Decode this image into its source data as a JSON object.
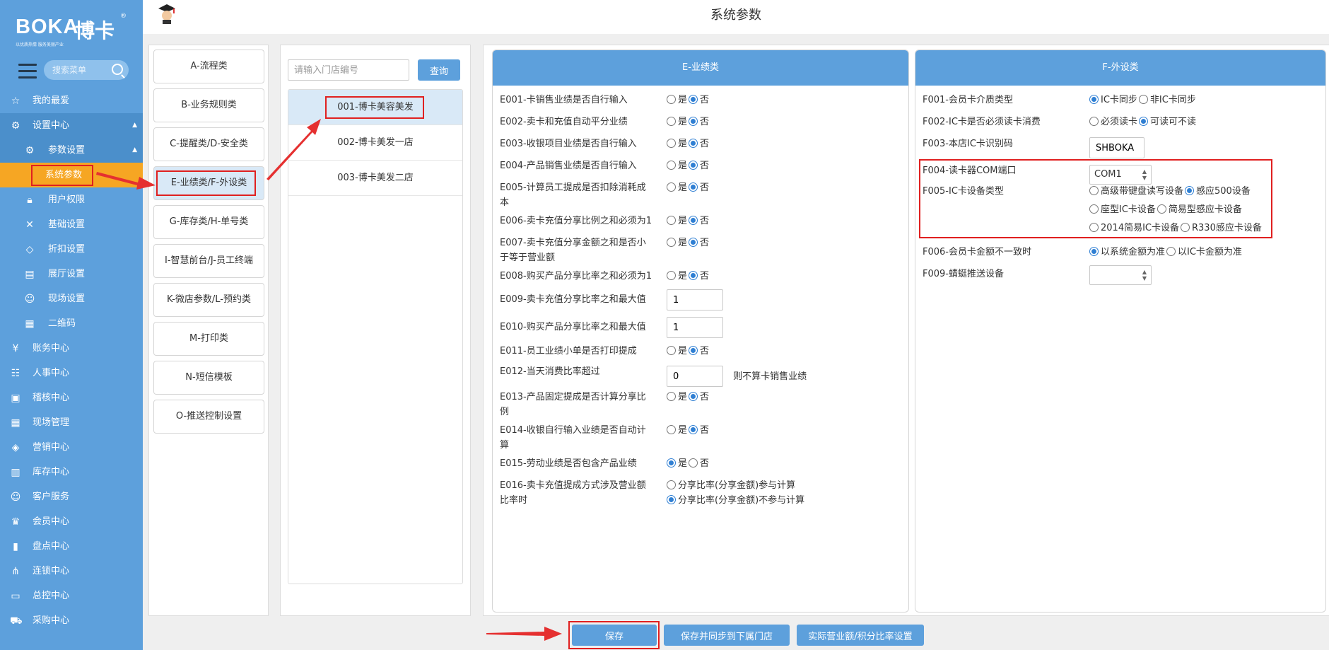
{
  "logo": {
    "brand": "BOKA",
    "brand_cn": "博卡",
    "reg": "®",
    "tagline": "以优质热情 服务美丽产业"
  },
  "sidebar": {
    "search_placeholder": "搜索菜单",
    "items": [
      {
        "label": "我的最爱",
        "icon": "star-icon"
      },
      {
        "label": "设置中心",
        "icon": "settings-icon"
      },
      {
        "label": "参数设置",
        "icon": "params-icon"
      },
      {
        "label": "系统参数",
        "icon": ""
      },
      {
        "label": "用户权限",
        "icon": "lock-icon"
      },
      {
        "label": "基础设置",
        "icon": "tools-icon"
      },
      {
        "label": "折扣设置",
        "icon": "tag-icon"
      },
      {
        "label": "展厅设置",
        "icon": "book-icon"
      },
      {
        "label": "现场设置",
        "icon": "user-icon"
      },
      {
        "label": "二维码",
        "icon": "qrcode-icon"
      },
      {
        "label": "账务中心",
        "icon": "yen-icon"
      },
      {
        "label": "人事中心",
        "icon": "people-icon"
      },
      {
        "label": "稽核中心",
        "icon": "audit-icon"
      },
      {
        "label": "现场管理",
        "icon": "grid-icon"
      },
      {
        "label": "营销中心",
        "icon": "marketing-icon"
      },
      {
        "label": "库存中心",
        "icon": "stock-icon"
      },
      {
        "label": "客户服务",
        "icon": "service-icon"
      },
      {
        "label": "会员中心",
        "icon": "crown-icon"
      },
      {
        "label": "盘点中心",
        "icon": "chart-icon"
      },
      {
        "label": "连锁中心",
        "icon": "chain-icon"
      },
      {
        "label": "总控中心",
        "icon": "monitor-icon"
      },
      {
        "label": "采购中心",
        "icon": "cart-icon"
      }
    ]
  },
  "header": {
    "title": "系统参数"
  },
  "categories": [
    "A-流程类",
    "B-业务规则类",
    "C-提醒类/D-安全类",
    "E-业绩类/F-外设类",
    "G-库存类/H-单号类",
    "I-智慧前台/J-员工终端",
    "K-微店参数/L-预约类",
    "M-打印类",
    "N-短信模板",
    "O-推送控制设置"
  ],
  "stores": {
    "search_placeholder": "请输入门店编号",
    "query_label": "查询",
    "items": [
      "001-博卡美容美发",
      "002-博卡美发一店",
      "003-博卡美发二店"
    ]
  },
  "radio_labels": {
    "yes": "是",
    "no": "否"
  },
  "e_section": {
    "title": "E-业绩类",
    "e001": "E001-卡销售业绩是否自行输入",
    "e002": "E002-卖卡和充值自动平分业绩",
    "e003": "E003-收银项目业绩是否自行输入",
    "e004": "E004-产品销售业绩是否自行输入",
    "e005a": "E005-计算员工提成是否扣除消耗成",
    "e005b": "本",
    "e006": "E006-卖卡充值分享比例之和必须为1",
    "e007a": "E007-卖卡充值分享金额之和是否小",
    "e007b": "于等于营业额",
    "e008": "E008-购买产品分享比率之和必须为1",
    "e009": "E009-卖卡充值分享比率之和最大值",
    "e009_value": "1",
    "e010": "E010-购买产品分享比率之和最大值",
    "e010_value": "1",
    "e011": "E011-员工业绩小单是否打印提成",
    "e012": "E012-当天消费比率超过",
    "e012_value": "0",
    "e012_suffix": "则不算卡销售业绩",
    "e013a": "E013-产品固定提成是否计算分享比",
    "e013b": "例",
    "e014a": "E014-收银自行输入业绩是否自动计",
    "e014b": "算",
    "e015": "E015-劳动业绩是否包含产品业绩",
    "e016a": "E016-卖卡充值提成方式涉及营业额",
    "e016b": "比率时",
    "e016_opt1": "分享比率(分享金额)参与计算",
    "e016_opt2": "分享比率(分享金额)不参与计算"
  },
  "f_section": {
    "title": "F-外设类",
    "f001": "F001-会员卡介质类型",
    "f001_opt1": "IC卡同步",
    "f001_opt2": "非IC卡同步",
    "f002": "F002-IC卡是否必须读卡消费",
    "f002_opt1": "必须读卡",
    "f002_opt2": "可读可不读",
    "f003": "F003-本店IC卡识别码",
    "f003_value": "SHBOKA",
    "f004": "F004-读卡器COM端口",
    "f004_value": "COM1",
    "f005": "F005-IC卡设备类型",
    "f005_opt1": "高级带键盘读写设备",
    "f005_opt2": "感应500设备",
    "f005_opt3": "座型IC卡设备",
    "f005_opt4": "简易型感应卡设备",
    "f005_opt5": "2014简易IC卡设备",
    "f005_opt6": "R330感应卡设备",
    "f006": "F006-会员卡金额不一致时",
    "f006_opt1": "以系统金额为准",
    "f006_opt2": "以IC卡金额为准",
    "f009": "F009-蜻蜓推送设备",
    "f009_value": ""
  },
  "footer": {
    "save": "保存",
    "save_sync": "保存并同步到下属门店",
    "ratio_settings": "实际营业额/积分比率设置"
  },
  "colors": {
    "sidebar": "#5da0dc",
    "active": "#f6a623",
    "highlight": "#e02020",
    "accent": "#2f7fd3"
  }
}
